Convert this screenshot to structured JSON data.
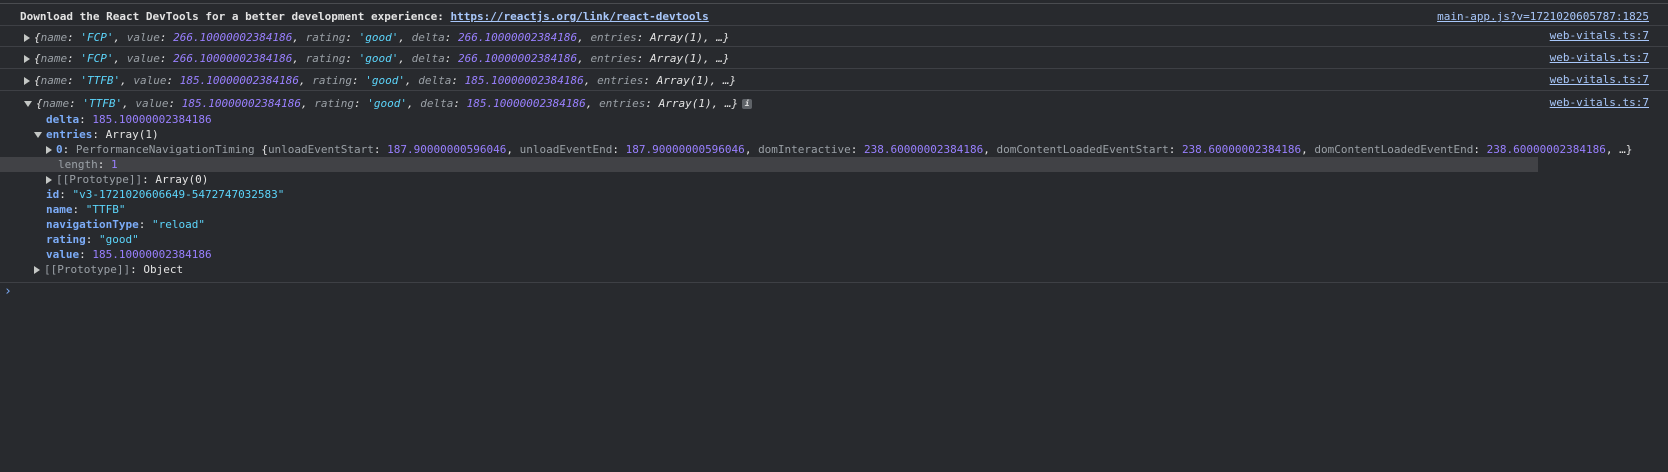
{
  "banner": {
    "text": "Download the React DevTools for a better development experience: ",
    "link": "https://reactjs.org/link/react-devtools",
    "source": "main-app.js?v=1721020605787:1825"
  },
  "logs": [
    {
      "source": "web-vitals.ts:7",
      "name_key": "name",
      "name_val": "'FCP'",
      "value_key": "value",
      "value_val": "266.10000002384186",
      "rating_key": "rating",
      "rating_val": "'good'",
      "delta_key": "delta",
      "delta_val": "266.10000002384186",
      "entries_key": "entries",
      "entries_val": "Array(1), …}"
    },
    {
      "source": "web-vitals.ts:7",
      "name_key": "name",
      "name_val": "'FCP'",
      "value_key": "value",
      "value_val": "266.10000002384186",
      "rating_key": "rating",
      "rating_val": "'good'",
      "delta_key": "delta",
      "delta_val": "266.10000002384186",
      "entries_key": "entries",
      "entries_val": "Array(1), …}"
    },
    {
      "source": "web-vitals.ts:7",
      "name_key": "name",
      "name_val": "'TTFB'",
      "value_key": "value",
      "value_val": "185.10000002384186",
      "rating_key": "rating",
      "rating_val": "'good'",
      "delta_key": "delta",
      "delta_val": "185.10000002384186",
      "entries_key": "entries",
      "entries_val": "Array(1), …}"
    },
    {
      "source": "web-vitals.ts:7",
      "name_key": "name",
      "name_val": "'TTFB'",
      "value_key": "value",
      "value_val": "185.10000002384186",
      "rating_key": "rating",
      "rating_val": "'good'",
      "delta_key": "delta",
      "delta_val": "185.10000002384186",
      "entries_key": "entries",
      "entries_val": "Array(1), …}"
    }
  ],
  "info_icon": "i",
  "expanded": {
    "delta_key": "delta",
    "delta_val": "185.10000002384186",
    "entries_key": "entries",
    "entries_val": "Array(1)",
    "entry0": {
      "index": "0",
      "type": "PerformanceNavigationTiming",
      "k1": "unloadEventStart",
      "v1": "187.90000000596046",
      "k2": "unloadEventEnd",
      "v2": "187.90000000596046",
      "k3": "domInteractive",
      "v3": "238.60000002384186",
      "k4": "domContentLoadedEventStart",
      "v4": "238.60000002384186",
      "k5": "domContentLoadedEventEnd",
      "v5": "238.60000002384186",
      "tail": ", …}"
    },
    "length_key": "length",
    "length_val": "1",
    "proto_arr_key": "[[Prototype]]",
    "proto_arr_val": "Array(0)",
    "id_key": "id",
    "id_val": "\"v3-1721020606649-5472747032583\"",
    "name_key": "name",
    "name_val": "\"TTFB\"",
    "navtype_key": "navigationType",
    "navtype_val": "\"reload\"",
    "rating_key": "rating",
    "rating_val": "\"good\"",
    "value_key": "value",
    "value_val": "185.10000002384186",
    "proto_obj_key": "[[Prototype]]",
    "proto_obj_val": "Object"
  },
  "prompt": "›"
}
